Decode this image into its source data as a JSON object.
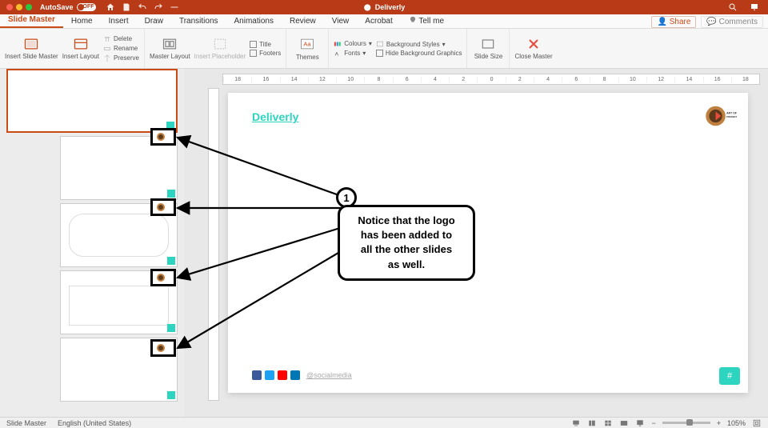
{
  "titlebar": {
    "autosave_label": "AutoSave",
    "autosave_state": "OFF",
    "doc_title": "Deliverly"
  },
  "menu": {
    "tabs": [
      "Slide Master",
      "Home",
      "Insert",
      "Draw",
      "Transitions",
      "Animations",
      "Review",
      "View",
      "Acrobat"
    ],
    "tell_me": "Tell me",
    "share": "Share",
    "comments": "Comments"
  },
  "ribbon": {
    "insert_slide_master": "Insert Slide Master",
    "insert_layout": "Insert Layout",
    "delete": "Delete",
    "rename": "Rename",
    "preserve": "Preserve",
    "master_layout": "Master Layout",
    "insert_placeholder": "Insert Placeholder",
    "title_chk": "Title",
    "footers_chk": "Footers",
    "themes": "Themes",
    "colours": "Colours",
    "fonts": "Fonts",
    "bg_styles": "Background Styles",
    "hide_bg": "Hide Background Graphics",
    "slide_size": "Slide Size",
    "close_master": "Close Master"
  },
  "slide": {
    "title_text": "Deliverly",
    "social_handle": "@socialmedia"
  },
  "annotation": {
    "number": "1",
    "text_l1": "Notice that the logo",
    "text_l2": "has been added to",
    "text_l3": "all the other slides",
    "text_l4": "as well."
  },
  "ruler_marks": [
    "18",
    "16",
    "14",
    "12",
    "10",
    "8",
    "6",
    "4",
    "2",
    "0",
    "2",
    "4",
    "6",
    "8",
    "10",
    "12",
    "14",
    "16",
    "18"
  ],
  "statusbar": {
    "view_label": "Slide Master",
    "lang": "English (United States)",
    "zoom": "105%"
  }
}
